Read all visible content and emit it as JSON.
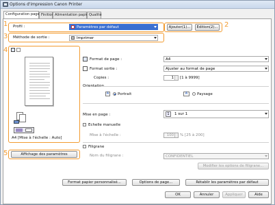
{
  "window": {
    "title": "Options d'impression Canon Printer"
  },
  "tabs": [
    "Configuration page",
    "Finition",
    "Alimentation papier",
    "Qualité"
  ],
  "profile": {
    "label": "Profil :",
    "value": "Paramètres par défaut",
    "add_label": "Ajouter(1)...",
    "edit_label": "Edition(2)..."
  },
  "output": {
    "label": "Méthode de sortie :",
    "value": "Imprimer"
  },
  "callouts": [
    "1",
    "2",
    "3",
    "4",
    "5"
  ],
  "preview": {
    "caption": "A4 [Mise à l'échelle : Auto]"
  },
  "settings_button": "Affichage des paramètres",
  "page_size": {
    "label": "Format de page :",
    "value": "A4"
  },
  "output_size": {
    "label": "Format sortie :",
    "value": "Ajuster au format de page"
  },
  "copies": {
    "label": "Copies :",
    "value": "1",
    "range": "[1 à 9999]"
  },
  "orientation": {
    "label": "Orientation",
    "portrait": "Portrait",
    "landscape": "Paysage"
  },
  "layout": {
    "label": "Mise en page :",
    "value": "1 sur 1",
    "badge": "1"
  },
  "manual_scaling": {
    "label": "Echelle manuelle",
    "scale_label": "Mise à l'échelle :",
    "scale_value": "100",
    "scale_range": "% [25 à 200]"
  },
  "watermark": {
    "label": "Filigrane",
    "name_label": "Nom du filigrane :",
    "name_value": "CONFIDENTIEL",
    "modify_label": "Modifier les options de filigrane..."
  },
  "bottom": {
    "custom_size": "Format papier personnalisé...",
    "page_options": "Options de page...",
    "restore": "Rétablir les paramètres par défaut"
  },
  "dialog": {
    "ok": "OK",
    "cancel": "Annuler",
    "apply": "Appliquer",
    "help": "Aide"
  },
  "colors": {
    "accent": "#f29a2e",
    "selection": "#3b6fd1"
  }
}
